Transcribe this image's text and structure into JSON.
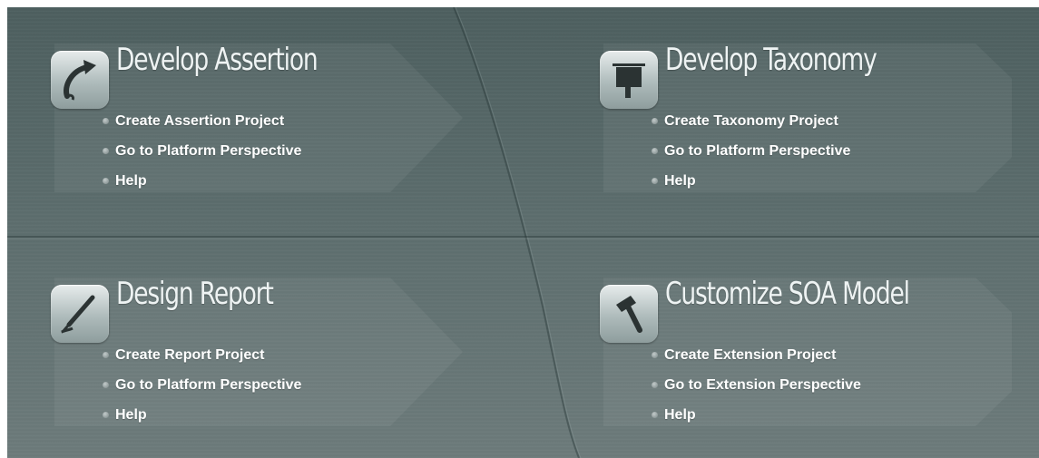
{
  "sections": [
    {
      "title": "Develop Assertion",
      "icon": "assertion-hook-icon",
      "links": [
        "Create Assertion Project",
        "Go to Platform Perspective",
        "Help"
      ]
    },
    {
      "title": "Develop Taxonomy",
      "icon": "taxonomy-sign-icon",
      "links": [
        "Create Taxonomy Project",
        "Go to Platform Perspective",
        "Help"
      ]
    },
    {
      "title": "Design Report",
      "icon": "report-pen-icon",
      "links": [
        "Create Report Project",
        "Go to Platform Perspective",
        "Help"
      ]
    },
    {
      "title": "Customize SOA Model",
      "icon": "hammer-icon",
      "links": [
        "Create Extension Project",
        "Go to Extension Perspective",
        "Help"
      ]
    }
  ],
  "colors": {
    "background": "#5c6d6d",
    "text": "#ffffff",
    "title": "#eef3f3"
  }
}
